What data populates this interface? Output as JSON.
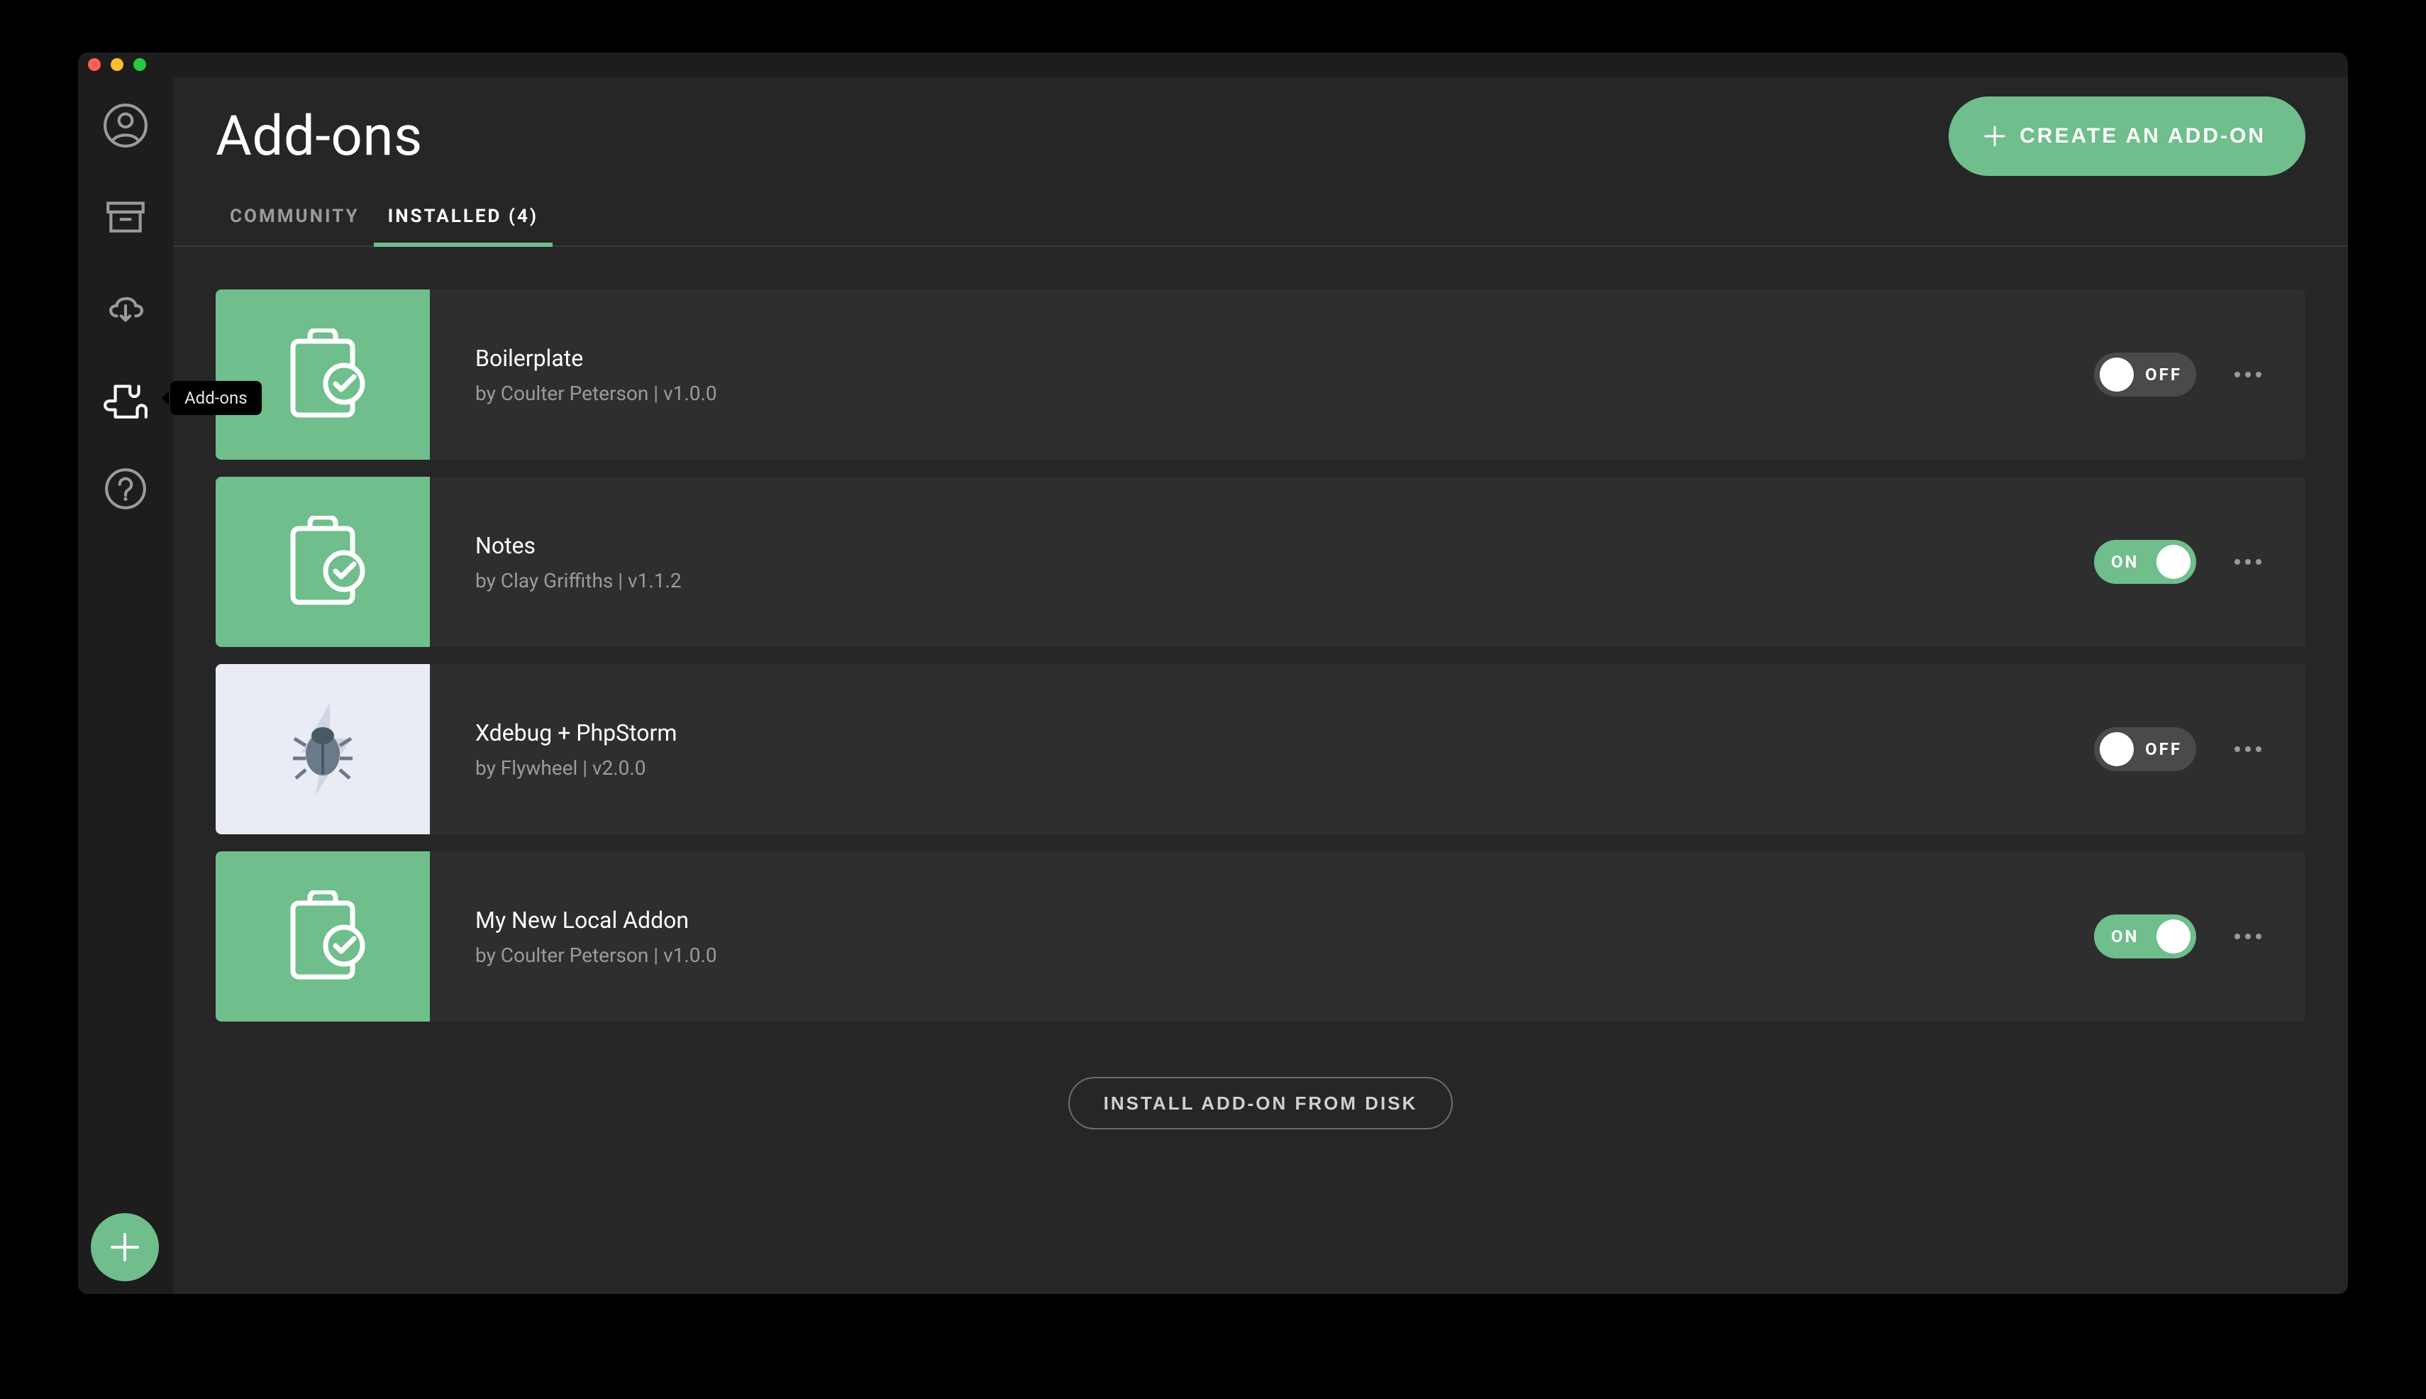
{
  "page": {
    "title": "Add-ons",
    "create_button": "CREATE AN ADD-ON",
    "install_button": "INSTALL ADD-ON FROM DISK"
  },
  "tabs": {
    "community": "COMMUNITY",
    "installed": "INSTALLED (4)"
  },
  "sidebar": {
    "tooltip_addons": "Add-ons"
  },
  "toggle_labels": {
    "on": "ON",
    "off": "OFF"
  },
  "addons": [
    {
      "name": "Boilerplate",
      "author": "Coulter Peterson",
      "version": "1.0.0",
      "enabled": false,
      "thumb": "clipboard"
    },
    {
      "name": "Notes",
      "author": "Clay Griffiths",
      "version": "1.1.2",
      "enabled": true,
      "thumb": "clipboard"
    },
    {
      "name": "Xdebug + PhpStorm",
      "author": "Flywheel",
      "version": "2.0.0",
      "enabled": false,
      "thumb": "bug"
    },
    {
      "name": "My New Local Addon",
      "author": "Coulter Peterson",
      "version": "1.0.0",
      "enabled": true,
      "thumb": "clipboard"
    }
  ]
}
